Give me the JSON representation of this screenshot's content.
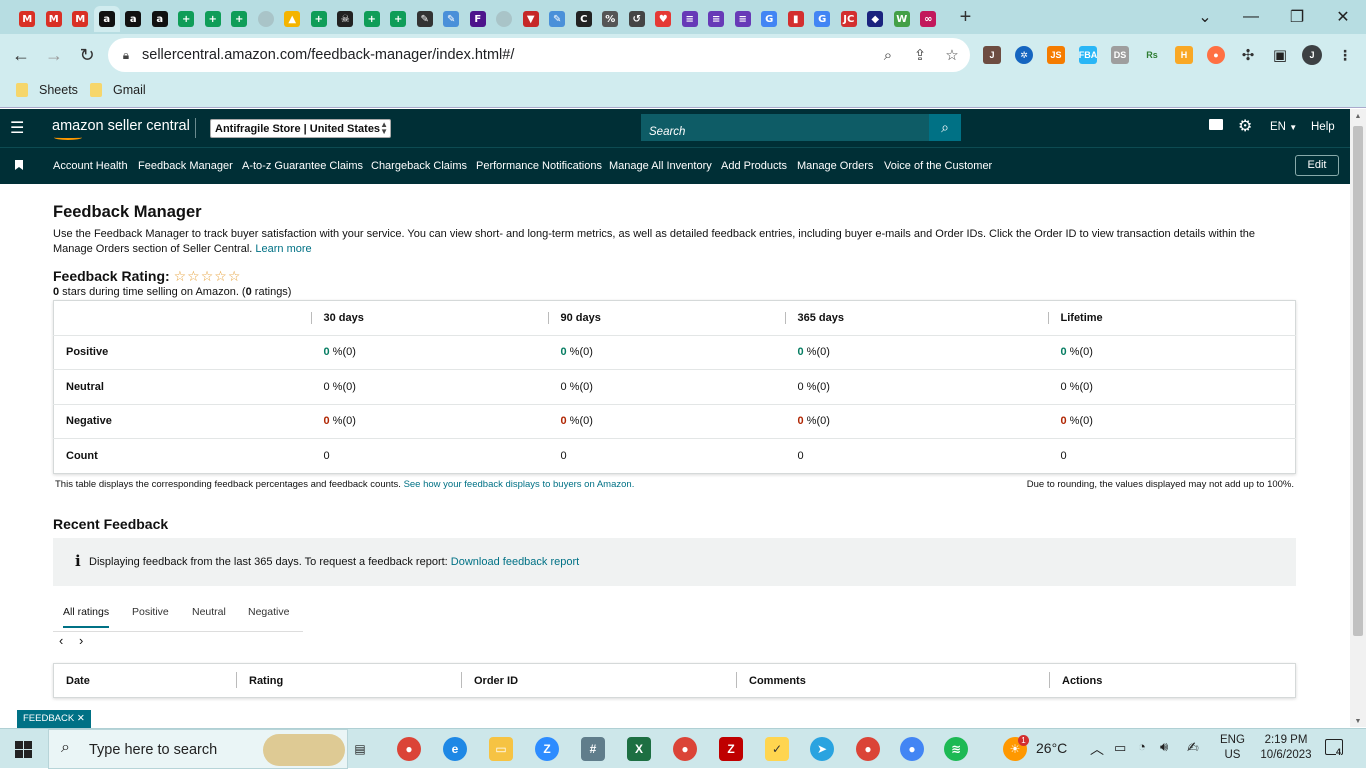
{
  "browser": {
    "tabs": [
      {
        "icon": "gmail-icon",
        "glyph": "M",
        "color": "#d93025"
      },
      {
        "icon": "gmail-icon",
        "glyph": "M",
        "color": "#d93025"
      },
      {
        "icon": "gmail-icon",
        "glyph": "M",
        "color": "#d93025"
      },
      {
        "icon": "amazon-icon",
        "glyph": "a",
        "color": "#111111",
        "active": true
      },
      {
        "icon": "amazon-icon",
        "glyph": "a",
        "color": "#111111"
      },
      {
        "icon": "amazon-icon",
        "glyph": "a",
        "color": "#111111"
      },
      {
        "icon": "sheets-plus-icon",
        "glyph": "+",
        "color": "#0f9d58"
      },
      {
        "icon": "sheets-plus-icon",
        "glyph": "+",
        "color": "#0f9d58"
      },
      {
        "icon": "sheets-plus-icon",
        "glyph": "+",
        "color": "#0f9d58"
      },
      {
        "icon": "grey-circle-icon",
        "glyph": "",
        "color": "#a9c4c8"
      },
      {
        "icon": "drive-icon",
        "glyph": "▲",
        "color": "#f4b400"
      },
      {
        "icon": "sheets-plus-icon",
        "glyph": "+",
        "color": "#0f9d58"
      },
      {
        "icon": "skull-icon",
        "glyph": "☠",
        "color": "#222222"
      },
      {
        "icon": "sheets-plus-icon",
        "glyph": "+",
        "color": "#0f9d58"
      },
      {
        "icon": "sheets-plus-icon",
        "glyph": "+",
        "color": "#0f9d58"
      },
      {
        "icon": "pen-icon",
        "glyph": "✎",
        "color": "#333333"
      },
      {
        "icon": "pencil-icon",
        "glyph": "✎",
        "color": "#4a90d9"
      },
      {
        "icon": "fedex-icon",
        "glyph": "F",
        "color": "#4d148c"
      },
      {
        "icon": "grey-circle-icon",
        "glyph": "",
        "color": "#a9c4c8"
      },
      {
        "icon": "funnel-icon",
        "glyph": "▼",
        "color": "#c62828"
      },
      {
        "icon": "pencil-icon",
        "glyph": "✎",
        "color": "#4a90d9"
      },
      {
        "icon": "dark-circle-icon",
        "glyph": "C",
        "color": "#222222"
      },
      {
        "icon": "chart-icon",
        "glyph": "%",
        "color": "#555555"
      },
      {
        "icon": "history-icon",
        "glyph": "↺",
        "color": "#444444"
      },
      {
        "icon": "heart-icon",
        "glyph": "♥",
        "color": "#e53935"
      },
      {
        "icon": "forms-icon",
        "glyph": "≡",
        "color": "#673ab7"
      },
      {
        "icon": "forms-icon",
        "glyph": "≡",
        "color": "#673ab7"
      },
      {
        "icon": "forms-icon",
        "glyph": "≡",
        "color": "#673ab7"
      },
      {
        "icon": "google-icon",
        "glyph": "G",
        "color": "#4285f4"
      },
      {
        "icon": "red-doc-icon",
        "glyph": "▮",
        "color": "#d32f2f"
      },
      {
        "icon": "google-icon",
        "glyph": "G",
        "color": "#4285f4"
      },
      {
        "icon": "jc-icon",
        "glyph": "JC",
        "color": "#d32f2f"
      },
      {
        "icon": "diamond-icon",
        "glyph": "◆",
        "color": "#1a237e"
      },
      {
        "icon": "w-icon",
        "glyph": "W",
        "color": "#43a047"
      },
      {
        "icon": "link-icon",
        "glyph": "∞",
        "color": "#c2185b"
      }
    ],
    "url": "sellercentral.amazon.com/feedback-manager/index.html#/",
    "profile_initial": "J",
    "bookmarks": [
      "Sheets",
      "Gmail"
    ]
  },
  "header": {
    "logo": "amazon seller central",
    "store_selector": "Antifragile Store | United States",
    "search_placeholder": "Search",
    "language": "EN",
    "help": "Help"
  },
  "nav": {
    "links": [
      "Account Health",
      "Feedback Manager",
      "A-to-z Guarantee Claims",
      "Chargeback Claims",
      "Performance Notifications",
      "Manage All Inventory",
      "Add Products",
      "Manage Orders",
      "Voice of the Customer"
    ],
    "edit": "Edit"
  },
  "page": {
    "title": "Feedback Manager",
    "description": "Use the Feedback Manager to track buyer satisfaction with your service. You can view short- and long-term metrics, as well as detailed feedback entries, including buyer e-mails and Order IDs. Click the Order ID to view transaction details within the Manage Orders section of Seller Central.",
    "learn_more": "Learn more",
    "rating_label": "Feedback Rating:",
    "stars_filled": 0,
    "stars_total": 5,
    "rating_summary_count": "0",
    "rating_summary_text": " stars during time selling on Amazon. (",
    "rating_summary_ratings": "0",
    "rating_summary_tail": " ratings)"
  },
  "feedback_table": {
    "columns": [
      "30 days",
      "90 days",
      "365 days",
      "Lifetime"
    ],
    "rows": [
      {
        "label": "Positive",
        "kind": "green",
        "cells": [
          [
            "0",
            " %(0)"
          ],
          [
            "0",
            " %(0)"
          ],
          [
            "0",
            " %(0)"
          ],
          [
            "0",
            " %(0)"
          ]
        ]
      },
      {
        "label": "Neutral",
        "kind": "plain",
        "cells": [
          [
            "0",
            " %(0)"
          ],
          [
            "0",
            " %(0)"
          ],
          [
            "0",
            " %(0)"
          ],
          [
            "0",
            " %(0)"
          ]
        ]
      },
      {
        "label": "Negative",
        "kind": "red",
        "cells": [
          [
            "0",
            " %(0)"
          ],
          [
            "0",
            " %(0)"
          ],
          [
            "0",
            " %(0)"
          ],
          [
            "0",
            " %(0)"
          ]
        ]
      },
      {
        "label": "Count",
        "kind": "plain",
        "cells": [
          [
            "0",
            ""
          ],
          [
            "0",
            ""
          ],
          [
            "0",
            ""
          ],
          [
            "0",
            ""
          ]
        ]
      }
    ],
    "footnote": "This table displays the corresponding feedback percentages and feedback counts.",
    "footnote_link": "See how your feedback displays to buyers on Amazon.",
    "rounding_note": "Due to rounding, the values displayed may not add up to 100%."
  },
  "recent": {
    "title": "Recent Feedback",
    "info_text": "Displaying feedback from the last 365 days. To request a feedback report:",
    "download_link": "Download feedback report",
    "tabs": [
      "All ratings",
      "Positive",
      "Neutral",
      "Negative"
    ],
    "active_tab": 0,
    "columns": [
      "Date",
      "Rating",
      "Order ID",
      "Comments",
      "Actions"
    ]
  },
  "feedback_badge": "FEEDBACK",
  "taskbar": {
    "search_placeholder": "Type here to search",
    "temperature": "26°C",
    "language": "ENG",
    "region": "US",
    "time": "2:19 PM",
    "date": "10/6/2023",
    "notifications": "4",
    "weather_badge": "1"
  },
  "colors": {
    "sc_header": "#002f36",
    "link": "#007185",
    "positive": "#067d62",
    "negative": "#b12704",
    "chrome": "#b7dde2"
  }
}
